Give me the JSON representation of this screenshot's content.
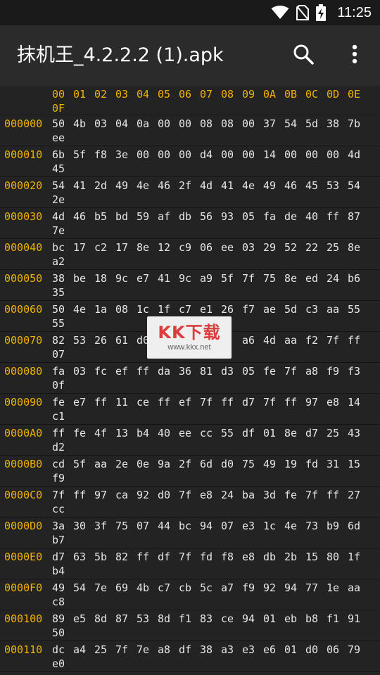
{
  "status_bar": {
    "time": "11:25",
    "icons": [
      "wifi-icon",
      "no-sim-icon",
      "battery-charging-icon"
    ]
  },
  "app_bar": {
    "title": "抹机王_4.2.2.2 (1).apk",
    "actions": [
      "search-icon",
      "more-vert-icon"
    ]
  },
  "colors": {
    "accent": "#f0b400",
    "background": "#232323",
    "toolbar": "#2b2b2b",
    "text": "#e6e6e6",
    "watermark_red": "#e93f3f"
  },
  "hex": {
    "columns": [
      "00",
      "01",
      "02",
      "03",
      "04",
      "05",
      "06",
      "07",
      "08",
      "09",
      "0A",
      "0B",
      "0C",
      "0D",
      "0E",
      "0F"
    ],
    "rows": [
      {
        "address": "000000",
        "bytes": [
          "50",
          "4b",
          "03",
          "04",
          "0a",
          "00",
          "00",
          "08",
          "08",
          "00",
          "37",
          "54",
          "5d",
          "38",
          "7b",
          "ee"
        ]
      },
      {
        "address": "000010",
        "bytes": [
          "6b",
          "5f",
          "f8",
          "3e",
          "00",
          "00",
          "00",
          "d4",
          "00",
          "00",
          "14",
          "00",
          "00",
          "00",
          "4d",
          "45"
        ]
      },
      {
        "address": "000020",
        "bytes": [
          "54",
          "41",
          "2d",
          "49",
          "4e",
          "46",
          "2f",
          "4d",
          "41",
          "4e",
          "49",
          "46",
          "45",
          "53",
          "54",
          "2e"
        ]
      },
      {
        "address": "000030",
        "bytes": [
          "4d",
          "46",
          "b5",
          "bd",
          "59",
          "af",
          "db",
          "56",
          "93",
          "05",
          "fa",
          "de",
          "40",
          "ff",
          "87",
          "7e"
        ]
      },
      {
        "address": "000040",
        "bytes": [
          "bc",
          "17",
          "c2",
          "17",
          "8e",
          "12",
          "c9",
          "06",
          "ee",
          "03",
          "29",
          "52",
          "22",
          "25",
          "8e",
          "a2"
        ]
      },
      {
        "address": "000050",
        "bytes": [
          "38",
          "be",
          "18",
          "9c",
          "e7",
          "41",
          "9c",
          "a9",
          "5f",
          "7f",
          "75",
          "8e",
          "ed",
          "24",
          "b6",
          "35"
        ]
      },
      {
        "address": "000060",
        "bytes": [
          "50",
          "4e",
          "1a",
          "08",
          "1c",
          "1f",
          "c7",
          "e1",
          "26",
          "f7",
          "ae",
          "5d",
          "c3",
          "aa",
          "55",
          "55"
        ]
      },
      {
        "address": "000070",
        "bytes": [
          "82",
          "53",
          "26",
          "61",
          "d0",
          "",
          "",
          "",
          "",
          "a6",
          "4d",
          "aa",
          "f2",
          "7f",
          "ff",
          "07"
        ]
      },
      {
        "address": "000080",
        "bytes": [
          "fa",
          "03",
          "fc",
          "ef",
          "ff",
          "da",
          "36",
          "81",
          "d3",
          "05",
          "fe",
          "7f",
          "a8",
          "f9",
          "f3",
          "0f"
        ]
      },
      {
        "address": "000090",
        "bytes": [
          "fe",
          "e7",
          "ff",
          "11",
          "ce",
          "ff",
          "ef",
          "7f",
          "ff",
          "d7",
          "7f",
          "ff",
          "97",
          "e8",
          "14",
          "c1"
        ]
      },
      {
        "address": "0000A0",
        "bytes": [
          "ff",
          "fe",
          "4f",
          "13",
          "b4",
          "40",
          "ee",
          "cc",
          "55",
          "df",
          "01",
          "8e",
          "d7",
          "25",
          "43",
          "d2"
        ]
      },
      {
        "address": "0000B0",
        "bytes": [
          "cd",
          "5f",
          "aa",
          "2e",
          "0e",
          "9a",
          "2f",
          "6d",
          "d0",
          "75",
          "49",
          "19",
          "fd",
          "31",
          "15",
          "f9"
        ]
      },
      {
        "address": "0000C0",
        "bytes": [
          "7f",
          "ff",
          "97",
          "ca",
          "92",
          "d0",
          "7f",
          "e8",
          "24",
          "ba",
          "3d",
          "fe",
          "7f",
          "ff",
          "27",
          "cc"
        ]
      },
      {
        "address": "0000D0",
        "bytes": [
          "3a",
          "30",
          "3f",
          "75",
          "07",
          "44",
          "bc",
          "94",
          "07",
          "e3",
          "1c",
          "4e",
          "73",
          "b9",
          "6d",
          "b7"
        ]
      },
      {
        "address": "0000E0",
        "bytes": [
          "d7",
          "63",
          "5b",
          "82",
          "ff",
          "df",
          "7f",
          "fd",
          "f8",
          "e8",
          "db",
          "2b",
          "15",
          "80",
          "1f",
          "b4"
        ]
      },
      {
        "address": "0000F0",
        "bytes": [
          "49",
          "54",
          "7e",
          "69",
          "4b",
          "c7",
          "cb",
          "5c",
          "a7",
          "f9",
          "92",
          "94",
          "77",
          "1e",
          "aa",
          "c8"
        ]
      },
      {
        "address": "000100",
        "bytes": [
          "89",
          "e5",
          "8d",
          "87",
          "53",
          "8d",
          "f1",
          "83",
          "ce",
          "94",
          "01",
          "eb",
          "b8",
          "f1",
          "91",
          "50"
        ]
      },
      {
        "address": "000110",
        "bytes": [
          "dc",
          "a4",
          "25",
          "7f",
          "7e",
          "a8",
          "df",
          "38",
          "a3",
          "e3",
          "e6",
          "01",
          "d0",
          "06",
          "79",
          "e0"
        ]
      }
    ]
  },
  "watermark": {
    "logo": "KK下载",
    "url": "www.kkx.net"
  }
}
